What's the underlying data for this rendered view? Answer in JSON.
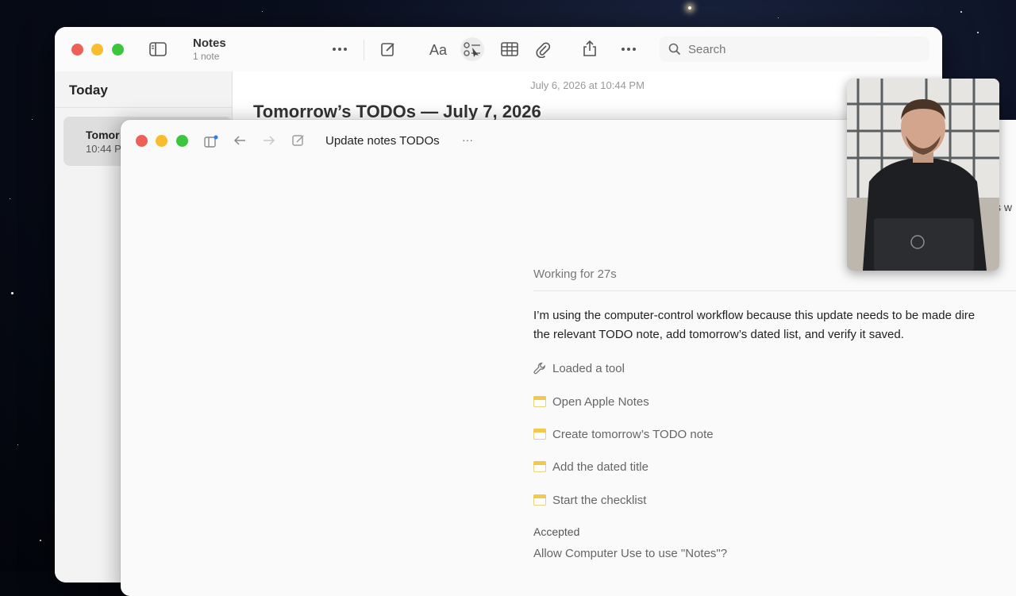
{
  "notes_window": {
    "toolbar": {
      "title": "Notes",
      "subtitle": "1 note",
      "search_placeholder": "Search"
    },
    "sidebar": {
      "section_header": "Today",
      "selected_note": {
        "title": "Tomor",
        "time": "10:44 P"
      }
    },
    "note": {
      "date": "July 6, 2026 at 10:44 PM",
      "title": "Tomorrow’s TODOs — July 7, 2026"
    }
  },
  "codex_window": {
    "title": "Update notes TODOs",
    "more_label": "···",
    "peek_text": "s w",
    "status": "Working for 27s",
    "message_line_1": "I’m using the computer-control workflow because this update needs to be made dire",
    "message_line_2": "the relevant TODO note, add tomorrow’s dated list, and verify it saved.",
    "tool_loaded": "Loaded a tool",
    "steps": [
      {
        "label": "Open Apple Notes"
      },
      {
        "label": "Create tomorrow’s TODO note"
      },
      {
        "label": "Add the dated title"
      },
      {
        "label": "Start the checklist"
      }
    ],
    "accepted_label": "Accepted",
    "permission_prompt": "Allow Computer Use to use \"Notes\"?"
  },
  "colors": {
    "traffic_red": "#ee5f57",
    "traffic_yellow": "#f6be2f",
    "traffic_green": "#3cc53f",
    "accent_blue": "#2f7bf6"
  },
  "icons": [
    "sidebar-toggle-icon",
    "ellipsis-icon",
    "compose-icon",
    "format-text-icon",
    "checklist-icon",
    "table-icon",
    "attachment-icon",
    "share-icon",
    "search-icon",
    "back-arrow-icon",
    "forward-arrow-icon",
    "wrench-icon",
    "note-icon"
  ]
}
